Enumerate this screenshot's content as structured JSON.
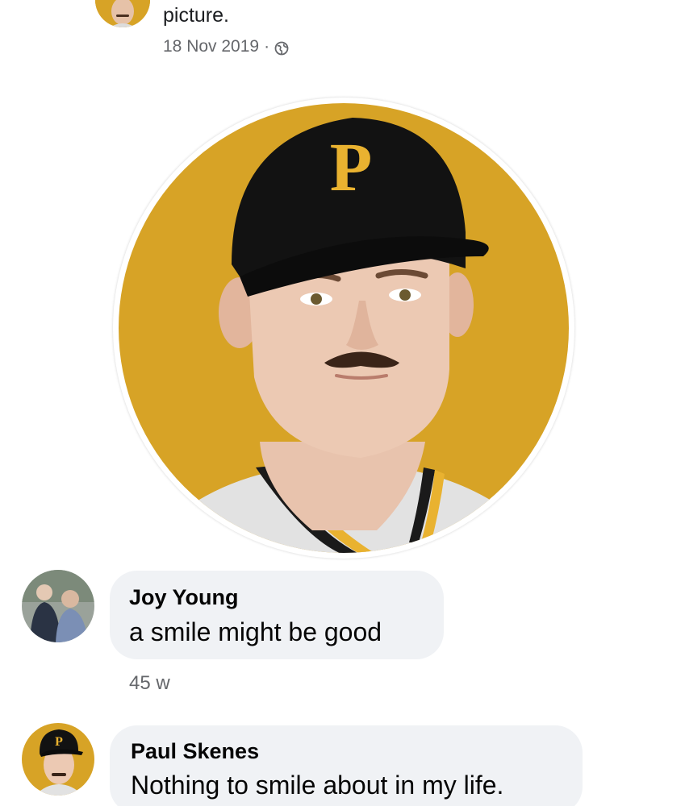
{
  "post": {
    "text": "picture.",
    "date": "18 Nov 2019",
    "separator": "·",
    "privacy_icon": "globe-icon"
  },
  "profile_picture": {
    "background_color": "#d7a326",
    "cap_letter": "P",
    "cap_color": "#1a1a1a",
    "logo_color": "#e9b230"
  },
  "comments": [
    {
      "author": "Joy Young",
      "text": "a smile might be good",
      "time": "45 w"
    },
    {
      "author": "Paul Skenes",
      "text": "Nothing to smile about in my life."
    }
  ],
  "colors": {
    "bubble": "#f0f2f5",
    "meta_text": "#65676b",
    "accent_gold": "#d7a326"
  }
}
